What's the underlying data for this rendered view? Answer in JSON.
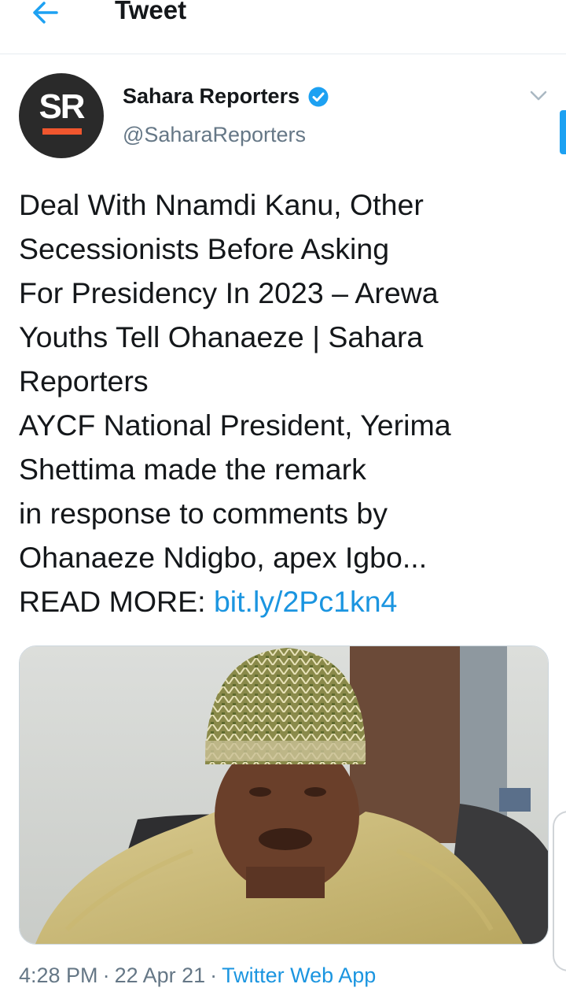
{
  "header": {
    "title": "Tweet",
    "back_icon": "arrow-left-icon"
  },
  "author": {
    "name": "Sahara Reporters",
    "handle": "@SaharaReporters",
    "avatar_text": "SR",
    "verified": true
  },
  "tweet": {
    "lines": [
      "Deal With Nnamdi Kanu, Other",
      "Secessionists Before Asking",
      "For Presidency In 2023 – Arewa",
      "Youths Tell Ohanaeze | Sahara",
      "Reporters",
      "AYCF National President, Yerima",
      "Shettima made the remark",
      "in response to comments by",
      "Ohanaeze Ndigbo, apex Igbo..."
    ],
    "read_more_label": "READ MORE: ",
    "link_text": "bit.ly/2Pc1kn4"
  },
  "meta": {
    "time": "4:28 PM",
    "date": "22 Apr 21",
    "source": "Twitter Web App"
  },
  "colors": {
    "link": "#1b95e0",
    "secondary_text": "#657786",
    "avatar_bg": "#2a2a2a",
    "avatar_bar": "#f0562e"
  }
}
